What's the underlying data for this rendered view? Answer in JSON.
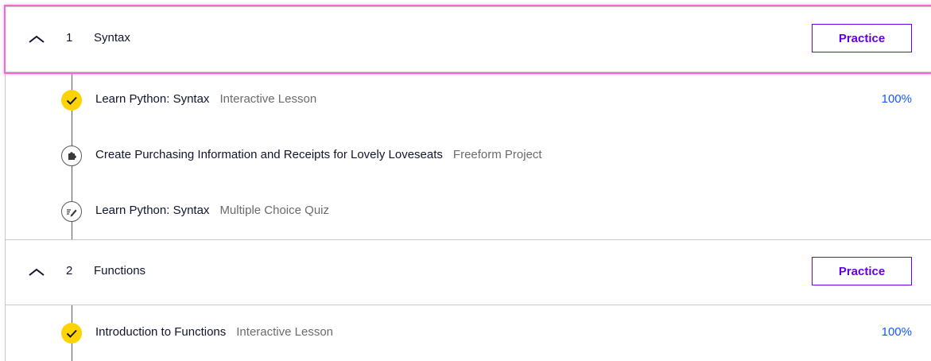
{
  "modules": [
    {
      "number": "1",
      "title": "Syntax",
      "practice_label": "Practice",
      "items": [
        {
          "title": "Learn Python: Syntax",
          "type": "Interactive Lesson",
          "progress": "100%",
          "icon": "check-icon"
        },
        {
          "title": "Create Purchasing Information and Receipts for Lovely Loveseats",
          "type": "Freeform Project",
          "progress": "",
          "icon": "puzzle-icon"
        },
        {
          "title": "Learn Python: Syntax",
          "type": "Multiple Choice Quiz",
          "progress": "",
          "icon": "quiz-pencil-icon"
        }
      ]
    },
    {
      "number": "2",
      "title": "Functions",
      "practice_label": "Practice",
      "items": [
        {
          "title": "Introduction to Functions",
          "type": "Interactive Lesson",
          "progress": "100%",
          "icon": "check-icon"
        }
      ]
    }
  ],
  "colors": {
    "accent": "#6400e4",
    "progress": "#1557ff",
    "complete": "#ffd300",
    "focus_ring": "#f06bcf"
  }
}
